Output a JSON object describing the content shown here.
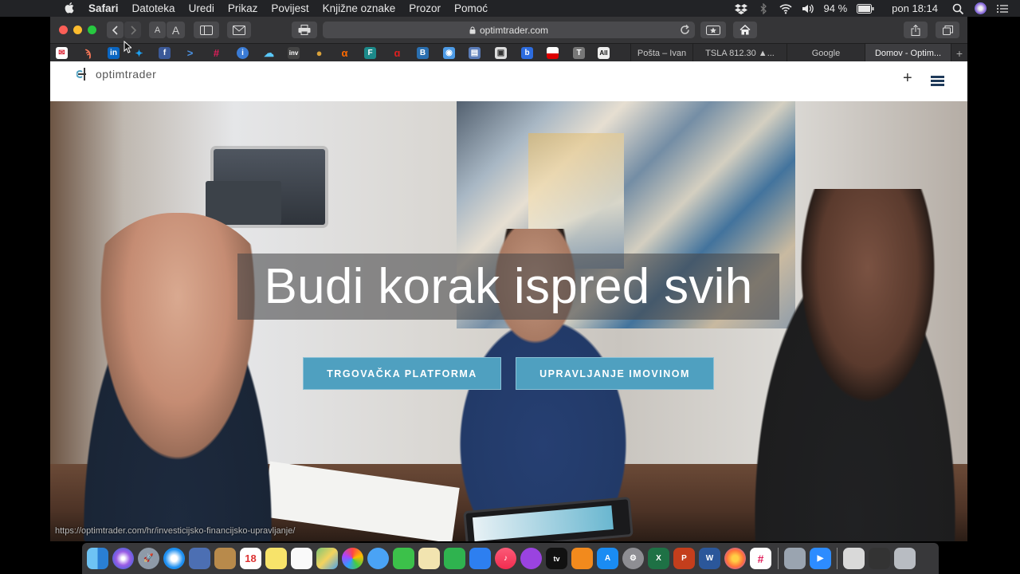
{
  "menubar": {
    "app_name": "Safari",
    "menus": [
      "Datoteka",
      "Uredi",
      "Prikaz",
      "Povijest",
      "Knjižne oznake",
      "Prozor",
      "Pomoć"
    ],
    "battery": "94 %",
    "clock": "pon 18:14"
  },
  "browser": {
    "url": "optimtrader.com",
    "font_small": "A",
    "font_large": "A",
    "tabs": [
      {
        "label": "Pošta – Ivan",
        "active": false
      },
      {
        "label": "TSLA 812.30 ▲...",
        "active": false
      },
      {
        "label": "Google",
        "active": false
      },
      {
        "label": "Domov - Optim...",
        "active": true
      }
    ],
    "new_tab": "+",
    "status_url": "https://optimtrader.com/hr/investicijsko-financijsko-upravljanje/"
  },
  "site": {
    "logo": "optimtrader",
    "plus": "+",
    "headline": "Budi korak ispred svih",
    "buttons": {
      "platform": "TRGOVAČKA PLATFORMA",
      "assets": "UPRAVLJANJE IMOVINOM"
    },
    "accent_color": "#4fa0c0"
  },
  "bookmark_icons": [
    "gmail-icon",
    "hubspot-icon",
    "linkedin-icon",
    "twitter-icon",
    "facebook-icon",
    "prompt-icon",
    "slack-icon",
    "info-icon",
    "cloud-icon",
    "investing-icon",
    "owl-icon",
    "alpha-icon",
    "f-icon",
    "acrobat-icon",
    "sheet-icon",
    "camera-icon",
    "reader-icon",
    "print-icon",
    "b-icon",
    "flag-icon",
    "t-icon",
    "all-icon"
  ]
}
